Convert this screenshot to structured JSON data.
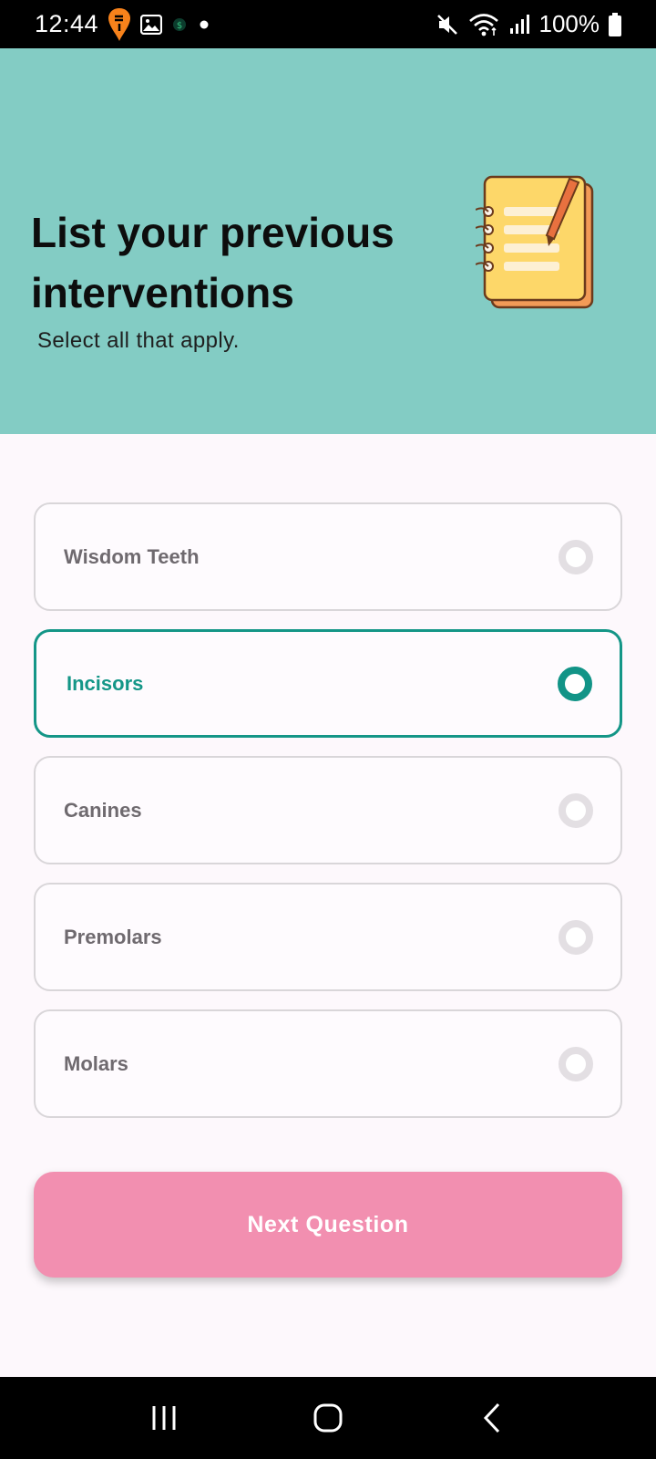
{
  "status_bar": {
    "time": "12:44",
    "battery": "100%",
    "icons": [
      "swiggy-icon",
      "gallery-icon",
      "app-icon",
      "dot-icon",
      "mute-icon",
      "wifi-icon",
      "signal-icon",
      "battery-icon"
    ]
  },
  "header": {
    "title": "List your previous interventions",
    "subtitle": "Select all that apply.",
    "icon": "notebook-icon",
    "background": "#83ccc4"
  },
  "options": [
    {
      "label": "Wisdom Teeth",
      "selected": false
    },
    {
      "label": "Incisors",
      "selected": true
    },
    {
      "label": "Canines",
      "selected": false
    },
    {
      "label": "Premolars",
      "selected": false
    },
    {
      "label": "Molars",
      "selected": false
    }
  ],
  "next_button": {
    "label": "Next Question",
    "color": "#f28fb0"
  },
  "accent_color": "#149687",
  "nav_bar": {
    "icons": [
      "recents-icon",
      "home-icon",
      "back-icon"
    ]
  }
}
